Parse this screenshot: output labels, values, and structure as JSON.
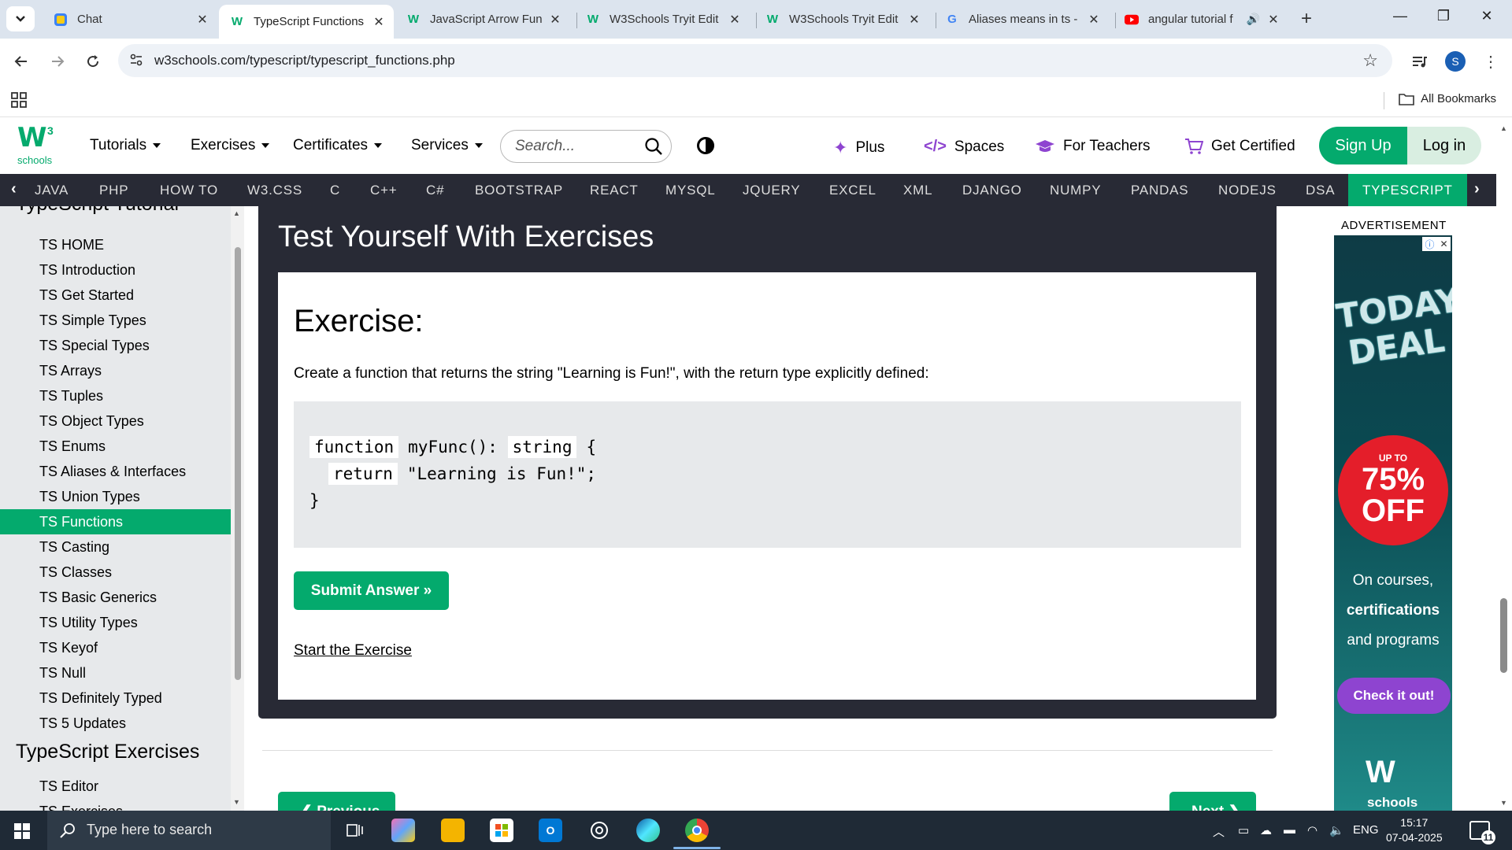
{
  "browser": {
    "tabs": [
      {
        "title": "Chat",
        "favicon": "copilot-icon"
      },
      {
        "title": "TypeScript Functions",
        "favicon": "w3schools-icon",
        "active": true
      },
      {
        "title": "JavaScript Arrow Fun",
        "favicon": "w3schools-icon"
      },
      {
        "title": "W3Schools Tryit Edit",
        "favicon": "w3schools-icon"
      },
      {
        "title": "W3Schools Tryit Edit",
        "favicon": "w3schools-icon"
      },
      {
        "title": "Aliases means in ts -",
        "favicon": "google-icon"
      },
      {
        "title": "angular tutorial f",
        "favicon": "youtube-icon"
      }
    ],
    "url": "w3schools.com/typescript/typescript_functions.php",
    "avatar_letter": "S",
    "bookmarks_label": "All Bookmarks"
  },
  "header": {
    "logo_sub": "schools",
    "logo_super": "3",
    "nav": [
      "Tutorials",
      "Exercises",
      "Certificates",
      "Services"
    ],
    "search_placeholder": "Search...",
    "right_links": [
      "Plus",
      "Spaces",
      "For Teachers",
      "Get Certified"
    ],
    "signup": "Sign Up",
    "login": "Log in"
  },
  "subnav": [
    "JAVA",
    "PHP",
    "HOW TO",
    "W3.CSS",
    "C",
    "C++",
    "C#",
    "BOOTSTRAP",
    "REACT",
    "MYSQL",
    "JQUERY",
    "EXCEL",
    "XML",
    "DJANGO",
    "NUMPY",
    "PANDAS",
    "NODEJS",
    "DSA",
    "TYPESCRIPT"
  ],
  "sidebar": {
    "header_cut": "TypeScript Tutorial",
    "items": [
      "TS HOME",
      "TS Introduction",
      "TS Get Started",
      "TS Simple Types",
      "TS Special Types",
      "TS Arrays",
      "TS Tuples",
      "TS Object Types",
      "TS Enums",
      "TS Aliases & Interfaces",
      "TS Union Types",
      "TS Functions",
      "TS Casting",
      "TS Classes",
      "TS Basic Generics",
      "TS Utility Types",
      "TS Keyof",
      "TS Null",
      "TS Definitely Typed",
      "TS 5 Updates"
    ],
    "active_item": "TS Functions",
    "section2": "TypeScript Exercises",
    "section2_items": [
      "TS Editor",
      "TS Exercises"
    ]
  },
  "main": {
    "panel_title": "Test Yourself With Exercises",
    "exercise_heading": "Exercise:",
    "question": "Create a function that returns the string \"Learning is Fun!\", with the return type explicitly defined:",
    "code": {
      "blank1": "function",
      "middle1": "myFunc():",
      "blank2": "string",
      "end1": "{",
      "blank3": "return",
      "end2": "\"Learning is Fun!\";",
      "close": "}"
    },
    "submit": "Submit Answer »",
    "start": "Start the Exercise",
    "prev": "❮ Previous",
    "next": "Next ❯"
  },
  "ad": {
    "label": "ADVERTISEMENT",
    "deal": "TODAY'S DEAL",
    "upto": "UP TO",
    "percent": "75%",
    "off": "OFF",
    "copy_line1": "On courses,",
    "copy_line2": "certifications",
    "copy_line3": "and programs",
    "cta": "Check it out!",
    "logo_sub": "schools"
  },
  "taskbar": {
    "search_placeholder": "Type here to search",
    "language": "ENG",
    "time": "15:17",
    "date": "07-04-2025",
    "notifications": "11"
  },
  "colors": {
    "accent": "#04aa6d",
    "dark": "#282a35",
    "sidebar_bg": "#e7e9eb"
  }
}
